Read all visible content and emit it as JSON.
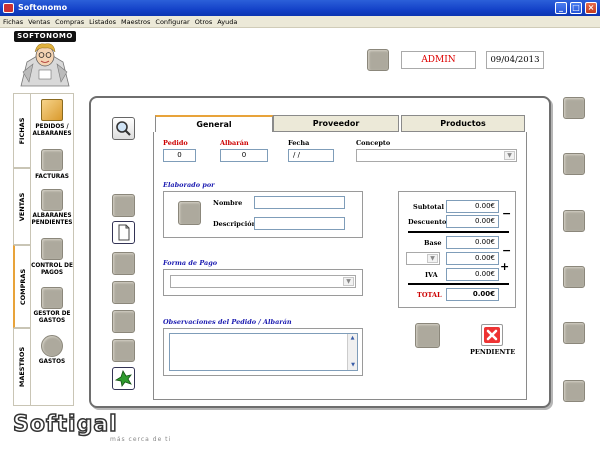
{
  "window": {
    "title": "Softonomo",
    "buttons": [
      "_",
      "□",
      "×"
    ]
  },
  "menu": [
    "Fichas",
    "Ventas",
    "Compras",
    "Listados",
    "Maestros",
    "Configurar",
    "Otros",
    "Ayuda"
  ],
  "logo": {
    "text": "SOFTONOMO"
  },
  "header": {
    "user": "ADMIN",
    "date": "09/04/2013"
  },
  "side_tabs": [
    "FICHAS",
    "VENTAS",
    "COMPRAS",
    "MAESTROS"
  ],
  "side_items": [
    {
      "label": "PEDIDOS / ALBARANES",
      "icon": "folder-icon"
    },
    {
      "label": "FACTURAS",
      "icon": "document-icon"
    },
    {
      "label": "ALBARANES PENDIENTES",
      "icon": "document-icon"
    },
    {
      "label": "CONTROL DE PAGOS",
      "icon": "document-icon"
    },
    {
      "label": "GESTOR DE GASTOS",
      "icon": "gear-icon"
    },
    {
      "label": "GASTOS",
      "icon": "coins-icon"
    }
  ],
  "tabs": [
    "General",
    "Proveedor",
    "Productos"
  ],
  "form": {
    "pedido_label": "Pedido",
    "pedido_value": "0",
    "albaran_label": "Albarán",
    "albaran_value": "0",
    "fecha_label": "Fecha",
    "fecha_value": "/ /",
    "concepto_label": "Concepto",
    "concepto_value": "",
    "elaborado_title": "Elaborado por",
    "nombre_label": "Nombre",
    "nombre_value": "",
    "descripcion_label": "Descripción",
    "descripcion_value": "",
    "forma_pago_title": "Forma de Pago",
    "forma_pago_value": "",
    "observaciones_title": "Observaciones del Pedido / Albarán",
    "observaciones_value": ""
  },
  "totals": {
    "subtotal_label": "Subtotal",
    "subtotal_value": "0.00€",
    "descuento_label": "Descuento",
    "descuento_value": "0.00€",
    "base_label": "Base",
    "base_value": "0.00€",
    "rate_value": "0.00€",
    "iva_label": "IVA",
    "iva_value": "0.00€",
    "total_label": "TOTAL",
    "total_value": "0.00€",
    "minus": "−",
    "plus": "+"
  },
  "status": {
    "label": "PENDIENTE"
  },
  "footer": {
    "brand": "Softigal",
    "tagline": "más cerca de ti"
  },
  "colors": {
    "accent": "#e8a33a",
    "red": "#cc0000",
    "blue_title": "#1a1ab0",
    "titlebar": "#1442c8"
  }
}
